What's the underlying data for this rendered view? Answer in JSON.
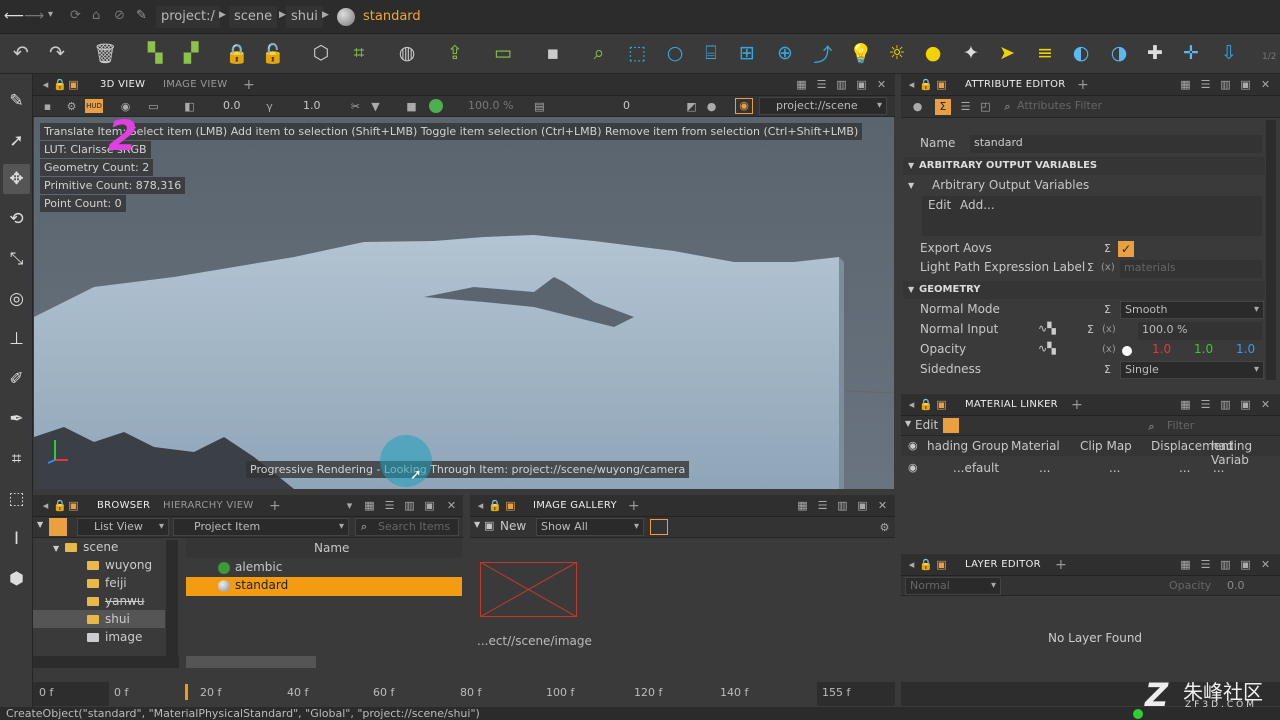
{
  "path": {
    "root": "project:/",
    "scene": "scene",
    "shui": "shui",
    "item": "standard"
  },
  "toolbar_icons": [
    "undo-icon",
    "redo-icon",
    "delete-icon",
    "group-icon",
    "ungroup-icon",
    "lock-icon",
    "unlock-icon",
    "cube-icon",
    "sphere-icon",
    "globe-icon",
    "import-icon",
    "chat-icon",
    "network-icon",
    "search-icon",
    "box-icon",
    "circle-icon",
    "cylinder-icon",
    "grid-icon",
    "globe-grid-icon",
    "arrow-icon",
    "bulb-icon",
    "sun-icon",
    "sphere-light-icon",
    "spot-icon",
    "directional-icon",
    "area-light-icon",
    "sky-icon",
    "env-icon",
    "add-icon",
    "plus-icon",
    "import-arrow-icon"
  ],
  "viewport": {
    "tab_active": "3D VIEW",
    "tab_other": "IMAGE VIEW",
    "exposure": "0.0",
    "gamma": "1.0",
    "zoom": "100.0 %",
    "frame": "0",
    "camera_path": "project://scene",
    "hud": {
      "hint": "Translate Item: Select item (LMB)  Add item to selection (Shift+LMB)  Toggle item selection (Ctrl+LMB)  Remove item from selection (Ctrl+Shift+LMB)",
      "lut": "LUT: Clarisse sRGB",
      "geometry": "Geometry Count: 2",
      "primitive": "Primitive Count: 878,316",
      "point": "Point Count: 0"
    },
    "annotation": "2",
    "progress": "Progressive Rendering - Looking Through Item: project://scene/wuyong/camera"
  },
  "attribute_editor": {
    "title": "ATTRIBUTE EDITOR",
    "filter_placeholder": "Attributes Filter",
    "name_label": "Name",
    "name_value": "standard",
    "aov_section": "ARBITRARY OUTPUT VARIABLES",
    "aov_group": "Arbitrary Output Variables",
    "edit": "Edit",
    "add": "Add...",
    "export_aovs": "Export Aovs",
    "light_path": "Light Path Expression Label",
    "light_path_value": "materials",
    "geometry_section": "GEOMETRY",
    "normal_mode": "Normal Mode",
    "normal_mode_value": "Smooth",
    "normal_input": "Normal Input",
    "normal_input_value": "100.0 %",
    "opacity": "Opacity",
    "opacity_r": "1.0",
    "opacity_g": "1.0",
    "opacity_b": "1.0",
    "sidedness": "Sidedness",
    "sidedness_value": "Single"
  },
  "material_linker": {
    "title": "MATERIAL LINKER",
    "edit": "Edit",
    "filter": "Filter",
    "columns": [
      "hading Group",
      "Material",
      "Clip Map",
      "Displacement",
      "hading Variab"
    ],
    "row": [
      "...efault",
      "...",
      "...",
      "...",
      "..."
    ]
  },
  "layer_editor": {
    "title": "LAYER EDITOR",
    "mode": "Normal",
    "opacity_label": "Opacity",
    "opacity_value": "0.0",
    "empty": "No Layer Found"
  },
  "browser": {
    "tab_active": "BROWSER",
    "tab_other": "HIERARCHY VIEW",
    "view_mode": "List View",
    "item_type": "Project Item",
    "search_placeholder": "Search Items",
    "tree": [
      "scene",
      "wuyong",
      "feiji",
      "yanwu",
      "shui",
      "image"
    ],
    "column": "Name",
    "items": [
      "alembic",
      "standard"
    ]
  },
  "gallery": {
    "title": "IMAGE GALLERY",
    "new": "New",
    "show": "Show All",
    "path": "...ect//scene/image"
  },
  "timeline": {
    "start": "0 f",
    "ticks": [
      "0 f",
      "20 f",
      "40 f",
      "60 f",
      "80 f",
      "100 f",
      "120 f",
      "140 f"
    ],
    "end": "155 f"
  },
  "status": "CreateObject(\"standard\", \"MaterialPhysicalStandard\", \"Global\", \"project://scene/shui\")",
  "watermark": {
    "text": "朱峰社区",
    "url": "ZF3D.COM"
  },
  "colors": {
    "accent": "#f39c12",
    "panel": "#3a3a3a",
    "header": "#2f2f2f"
  }
}
